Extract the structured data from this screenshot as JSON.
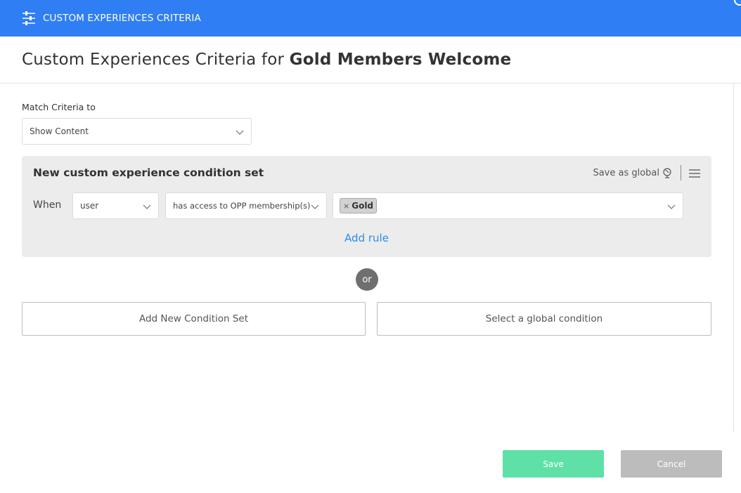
{
  "topbar": {
    "icon": "sliders-icon",
    "title": "CUSTOM EXPERIENCES CRITERIA"
  },
  "header": {
    "title_prefix": "Custom Experiences Criteria for ",
    "title_name": "Gold Members Welcome"
  },
  "match": {
    "label": "Match Criteria to",
    "value": "Show Content"
  },
  "condition_set": {
    "title": "New custom experience condition set",
    "save_as_global": "Save as global",
    "save_icon": "globe-icon",
    "menu_icon": "hamburger-menu-icon",
    "rule": {
      "when_label": "When",
      "subject": "user",
      "operator": "has access to OPP membership(s)",
      "values": [
        {
          "remove": "×",
          "label": "Gold"
        }
      ]
    },
    "add_rule": "Add rule"
  },
  "or_label": "or",
  "actions": {
    "add_condition_set": "Add New Condition Set",
    "select_global": "Select a global condition"
  },
  "footer": {
    "save": "Save",
    "cancel": "Cancel"
  },
  "colors": {
    "brand_blue": "#2f7ef3",
    "link_blue": "#2f8ae6",
    "save_green": "#5fe0a6",
    "cancel_gray": "#bcbcbc"
  }
}
